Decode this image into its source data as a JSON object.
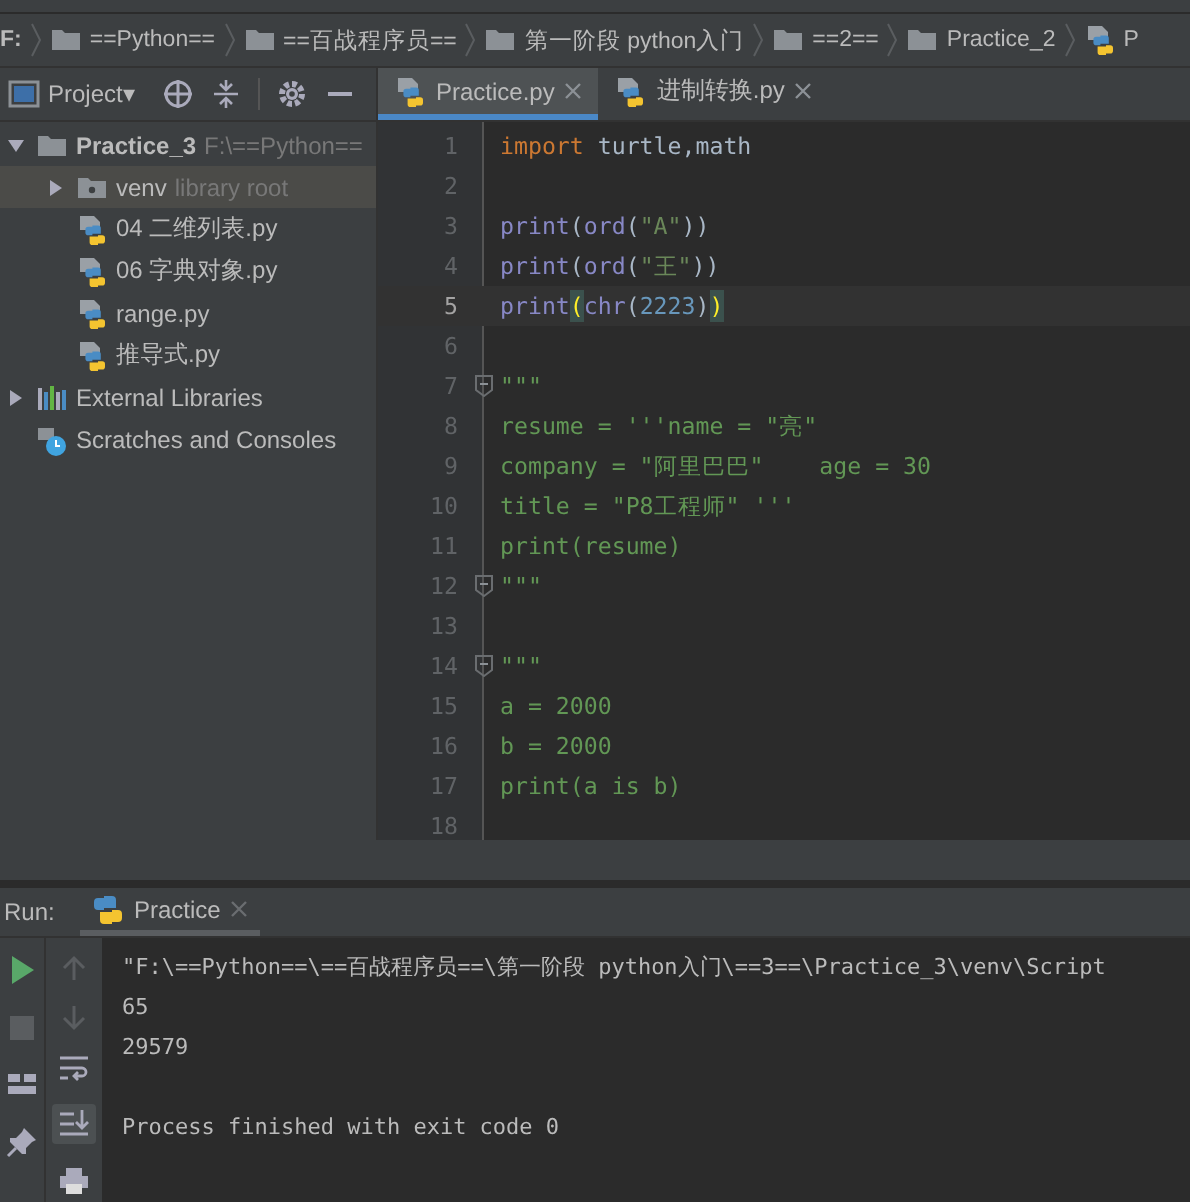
{
  "breadcrumb": [
    {
      "label": "F:",
      "kind": "drive"
    },
    {
      "label": "==Python==",
      "kind": "folder"
    },
    {
      "label": "==百战程序员==",
      "kind": "folder"
    },
    {
      "label": "第一阶段 python入门",
      "kind": "folder"
    },
    {
      "label": "==2==",
      "kind": "folder"
    },
    {
      "label": "Practice_2",
      "kind": "folder"
    },
    {
      "label": "P",
      "kind": "file"
    }
  ],
  "project_panel": {
    "title": "Project▾",
    "tree": [
      {
        "label": "Practice_3",
        "hint": "F:\\==Python==",
        "kind": "folder",
        "expanded": true,
        "selected": false,
        "children": [
          {
            "label": "venv",
            "hint": "library root",
            "kind": "lib-folder",
            "expanded": false,
            "selected": true
          },
          {
            "label": "04 二维列表.py",
            "kind": "python",
            "selected": false
          },
          {
            "label": "06 字典对象.py",
            "kind": "python",
            "selected": false
          },
          {
            "label": "range.py",
            "kind": "python",
            "selected": false
          },
          {
            "label": "推导式.py",
            "kind": "python",
            "selected": false
          }
        ]
      },
      {
        "label": "External Libraries",
        "kind": "libraries",
        "expanded": false,
        "selected": false
      },
      {
        "label": "Scratches and Consoles",
        "kind": "scratches",
        "selected": false
      }
    ]
  },
  "editor_tabs": [
    {
      "label": "Practice.py",
      "selected": true
    },
    {
      "label": "进制转换.py",
      "selected": false
    }
  ],
  "code_lines": [
    {
      "number": "1",
      "current": false,
      "tokens": [
        {
          "text": "import",
          "kind": "keyword"
        },
        {
          "text": " turtle,math",
          "kind": "plain"
        }
      ]
    },
    {
      "number": "2",
      "current": false
    },
    {
      "number": "3",
      "current": false,
      "tokens": [
        {
          "text": "print",
          "kind": "builtin"
        },
        {
          "text": "(",
          "kind": "plain"
        },
        {
          "text": "ord",
          "kind": "builtin"
        },
        {
          "text": "(",
          "kind": "plain"
        },
        {
          "text": "\"A\"",
          "kind": "string"
        },
        {
          "text": "))",
          "kind": "plain"
        }
      ]
    },
    {
      "number": "4",
      "current": false,
      "tokens": [
        {
          "text": "print",
          "kind": "builtin"
        },
        {
          "text": "(",
          "kind": "plain"
        },
        {
          "text": "ord",
          "kind": "builtin"
        },
        {
          "text": "(",
          "kind": "plain"
        },
        {
          "text": "\"王\"",
          "kind": "string"
        },
        {
          "text": "))",
          "kind": "plain"
        }
      ]
    },
    {
      "number": "5",
      "current": true,
      "tokens": [
        {
          "text": "print",
          "kind": "builtin"
        },
        {
          "text": "(",
          "kind": "brace"
        },
        {
          "text": "chr",
          "kind": "builtin"
        },
        {
          "text": "(",
          "kind": "plain"
        },
        {
          "text": "2223",
          "kind": "number"
        },
        {
          "text": ")",
          "kind": "plain"
        },
        {
          "text": ")",
          "kind": "brace"
        }
      ]
    },
    {
      "number": "6",
      "current": false
    },
    {
      "number": "7",
      "current": false,
      "fold": true,
      "tokens": [
        {
          "text": "\"\"\"",
          "kind": "doc"
        }
      ]
    },
    {
      "number": "8",
      "current": false,
      "tokens": [
        {
          "text": "resume = '''name = \"亮\"",
          "kind": "doc"
        }
      ]
    },
    {
      "number": "9",
      "current": false,
      "tokens": [
        {
          "text": "company = \"阿里巴巴\"    age = 30",
          "kind": "doc"
        }
      ]
    },
    {
      "number": "10",
      "current": false,
      "tokens": [
        {
          "text": "title = \"P8工程师\" '''",
          "kind": "doc"
        }
      ]
    },
    {
      "number": "11",
      "current": false,
      "tokens": [
        {
          "text": "print(resume)",
          "kind": "doc"
        }
      ]
    },
    {
      "number": "12",
      "current": false,
      "fold": true,
      "tokens": [
        {
          "text": "\"\"\"",
          "kind": "doc"
        }
      ]
    },
    {
      "number": "13",
      "current": false
    },
    {
      "number": "14",
      "current": false,
      "fold": true,
      "tokens": [
        {
          "text": "\"\"\"",
          "kind": "doc"
        }
      ]
    },
    {
      "number": "15",
      "current": false,
      "tokens": [
        {
          "text": "a = 2000",
          "kind": "doc"
        }
      ]
    },
    {
      "number": "16",
      "current": false,
      "tokens": [
        {
          "text": "b = 2000",
          "kind": "doc"
        }
      ]
    },
    {
      "number": "17",
      "current": false,
      "tokens": [
        {
          "text": "print(a is b)",
          "kind": "doc"
        }
      ]
    },
    {
      "number": "18",
      "current": false
    }
  ],
  "run_panel": {
    "label": "Run:",
    "tab": "Practice",
    "output": [
      {
        "text": "\"F:\\==Python==\\==百战程序员==\\第一阶段 python入门\\==3==\\Practice_3\\venv\\Script",
        "kind": "stdout"
      },
      {
        "text": "65",
        "kind": "stdout"
      },
      {
        "text": "29579",
        "kind": "stdout"
      },
      {
        "text": "Process finished with exit code 0",
        "kind": "exit"
      }
    ]
  }
}
